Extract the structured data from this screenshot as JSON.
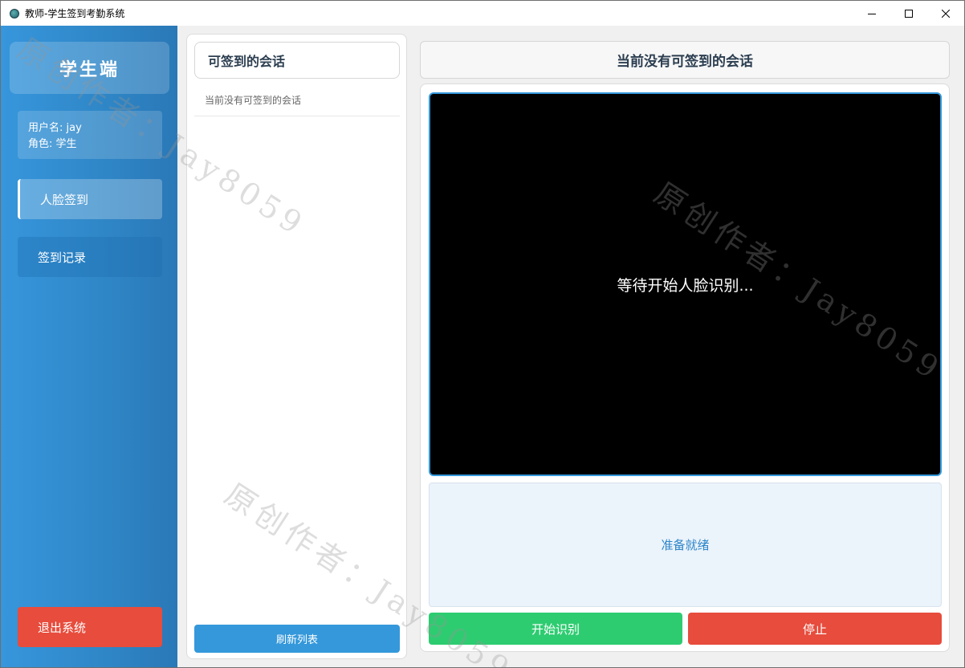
{
  "window": {
    "title": "教师-学生签到考勤系统"
  },
  "sidebar": {
    "brand": "学生端",
    "user_info": {
      "username_line": "用户名: jay",
      "role_line": "角色: 学生"
    },
    "nav": [
      {
        "label": "人脸签到",
        "active": true
      },
      {
        "label": "签到记录",
        "active": false
      }
    ],
    "logout_label": "退出系统"
  },
  "sessions_panel": {
    "title": "可签到的会话",
    "items": [
      "当前没有可签到的会话"
    ],
    "refresh_label": "刷新列表"
  },
  "checkin_panel": {
    "header": "当前没有可签到的会话",
    "camera_text": "等待开始人脸识别...",
    "status_text": "准备就绪",
    "start_label": "开始识别",
    "stop_label": "停止"
  },
  "watermark": {
    "text": "原创作者：Jay8059"
  },
  "colors": {
    "sidebar": "#3290d4",
    "primary": "#3498db",
    "success": "#2ecc71",
    "danger": "#e74c3c",
    "status_bg": "#ebf3fb"
  }
}
